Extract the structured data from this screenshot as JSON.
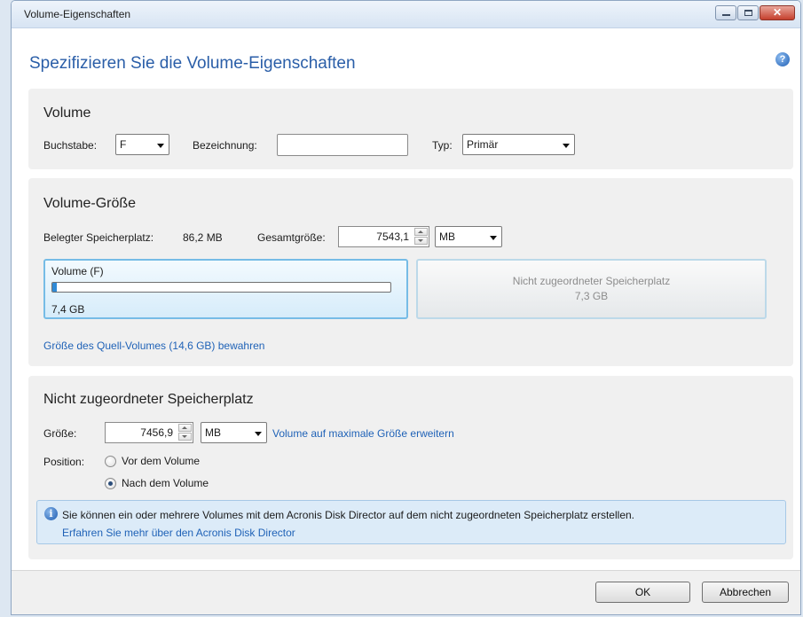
{
  "window": {
    "title": "Volume-Eigenschaften"
  },
  "header": {
    "title": "Spezifizieren Sie die Volume-Eigenschaften",
    "help_glyph": "?"
  },
  "volume_section": {
    "title": "Volume",
    "letter_label": "Buchstabe:",
    "letter_value": "F",
    "name_label": "Bezeichnung:",
    "name_value": "",
    "type_label": "Typ:",
    "type_value": "Primär"
  },
  "size_section": {
    "title": "Volume-Größe",
    "used_label": "Belegter Speicherplatz:",
    "used_value": "86,2 MB",
    "total_label": "Gesamtgröße:",
    "total_value": "7543,1",
    "unit_value": "MB",
    "volume_card": {
      "name": "Volume (F)",
      "size": "7,4 GB",
      "fill_fraction": 0.012
    },
    "unallocated_card": {
      "title": "Nicht zugeordneter Speicherplatz",
      "size": "7,3 GB"
    },
    "keep_source_link": "Größe des Quell-Volumes (14,6 GB) bewahren"
  },
  "unallocated_section": {
    "title": "Nicht zugeordneter Speicherplatz",
    "size_label": "Größe:",
    "size_value": "7456,9",
    "unit_value": "MB",
    "expand_link": "Volume auf maximale Größe erweitern",
    "position_label": "Position:",
    "positions": [
      {
        "label": "Vor dem Volume",
        "selected": false
      },
      {
        "label": "Nach dem Volume",
        "selected": true
      }
    ],
    "info": {
      "icon": "i",
      "text": "Sie können ein oder mehrere Volumes mit dem Acronis Disk Director auf dem nicht zugeordneten Speicherplatz erstellen.",
      "link": "Erfahren Sie mehr über den Acronis Disk Director"
    }
  },
  "footer": {
    "ok_label": "OK",
    "cancel_label": "Abbrechen"
  },
  "colors": {
    "accent": "#2a5ea8",
    "link": "#1f62b7",
    "progress": "#2f8ad6"
  }
}
